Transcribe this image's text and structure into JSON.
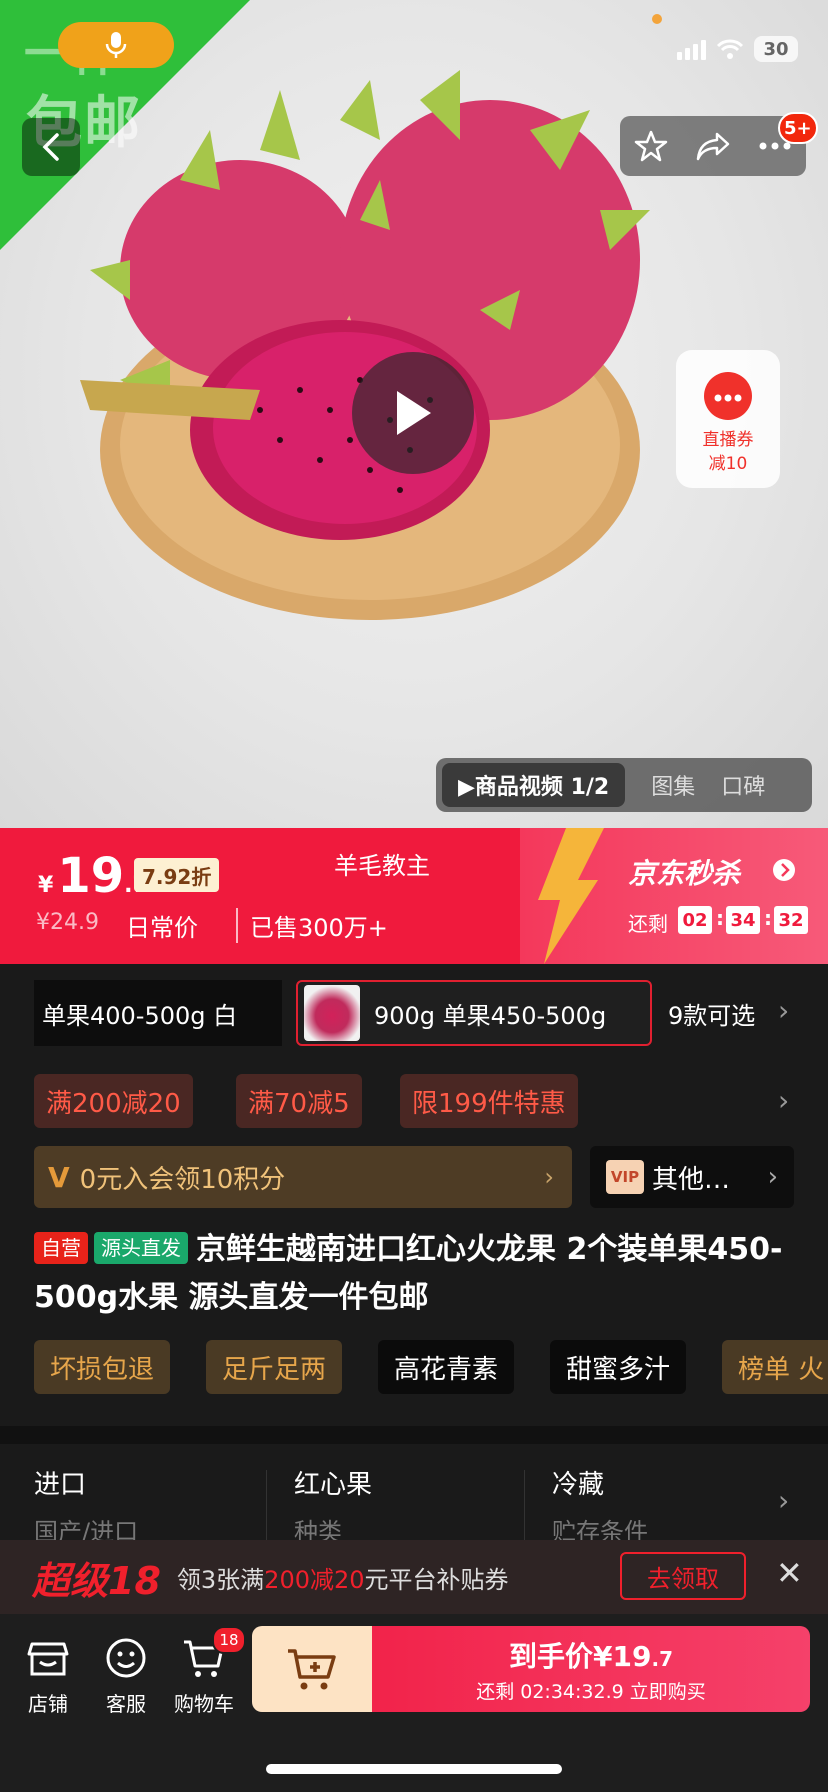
{
  "hero": {
    "banner_text": "包邮",
    "banner_text_partial": "一件",
    "badge": "5+",
    "live_coupon": {
      "line1": "直播券",
      "line2": "减10"
    },
    "media_tabs": {
      "video": "▶商品视频 1/2",
      "gallery": "图集",
      "reviews": "口碑"
    }
  },
  "status_bar": {
    "battery": "30"
  },
  "price": {
    "currency": "¥",
    "integer": "19",
    "decimal": ".7",
    "discount": "7.92折",
    "promoter": "羊毛教主",
    "original": "¥24.9",
    "daily_label": "日常价",
    "sold": "已售300万+",
    "seckill_title": "京东秒杀",
    "remain_label": "还剩",
    "timer": {
      "h": "02",
      "m": "34",
      "s": "32"
    }
  },
  "variants": {
    "option1": "单果400-500g 白",
    "option2": "900g 单果450-500g",
    "more": "9款可选"
  },
  "promos": [
    "满200减20",
    "满70减5",
    "限199件特惠"
  ],
  "member": {
    "text": "0元入会领10积分",
    "vip_badge": "VIP",
    "vip_text": "其他…"
  },
  "product": {
    "tag_self": "自营",
    "tag_source": "源头直发",
    "title": "京鲜生越南进口红心火龙果 2个装单果450-500g水果 源头直发一件包邮"
  },
  "features": [
    "坏损包退",
    "足斤足两",
    "高花青素",
    "甜蜜多汁",
    "榜单 火"
  ],
  "specs": [
    {
      "key": "进口",
      "value": "国产/进口"
    },
    {
      "key": "红心果",
      "value": "种类"
    },
    {
      "key": "冷藏",
      "value": "贮存条件"
    }
  ],
  "coupon_strip": {
    "brand": "超级18",
    "text_before": "领3张满",
    "text_red": "200减20",
    "text_after": "元平台补贴券",
    "button": "去领取"
  },
  "bottom_bar": {
    "store": "店铺",
    "service": "客服",
    "cart": "购物车",
    "cart_count": "18",
    "buy_main": "到手价¥19",
    "buy_main_dec": ".7",
    "buy_sub": "还剩 02:34:32.9 立即购买"
  },
  "colors": {
    "accent_red": "#f01a3d",
    "seckill_pink": "#f75a79",
    "banner_green": "#2fbf3a"
  }
}
